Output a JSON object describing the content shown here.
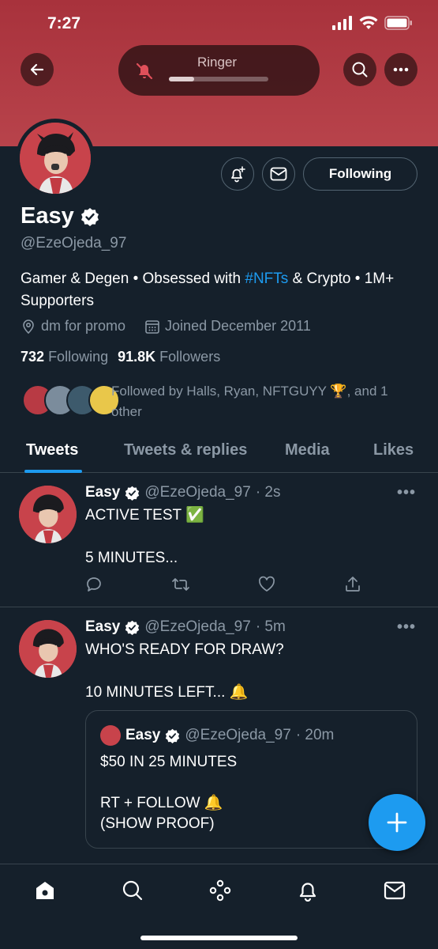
{
  "status_bar": {
    "time": "7:27"
  },
  "ringer": {
    "label": "Ringer",
    "level": 0.25
  },
  "profile": {
    "name": "Easy",
    "handle": "@EzeOjeda_97",
    "bio_prefix": "Gamer & Degen • Obsessed with ",
    "bio_link": "#NFTs",
    "bio_suffix": " & Crypto • 1M+ Supporters",
    "location": "dm for promo",
    "joined": "Joined December 2011",
    "following_count": "732",
    "following_label": "Following",
    "followers_count": "91.8K",
    "followers_label": "Followers",
    "followed_by": "Followed by Halls, Ryan, NFTGUYY 🏆, and 1 other",
    "follow_button": "Following"
  },
  "tabs": [
    {
      "label": "Tweets",
      "active": true
    },
    {
      "label": "Tweets & replies",
      "active": false
    },
    {
      "label": "Media",
      "active": false
    },
    {
      "label": "Likes",
      "active": false
    }
  ],
  "tweets": [
    {
      "name": "Easy",
      "handle": "@EzeOjeda_97",
      "time": "· 2s",
      "text": "ACTIVE TEST ✅\n\n5 MINUTES..."
    },
    {
      "name": "Easy",
      "handle": "@EzeOjeda_97",
      "time": "· 5m",
      "text": "WHO'S READY FOR DRAW?\n\n10 MINUTES LEFT... 🔔",
      "quote": {
        "name": "Easy",
        "handle": "@EzeOjeda_97",
        "time": "· 20m",
        "text": "$50 IN 25 MINUTES\n\nRT + FOLLOW 🔔\n(SHOW PROOF)"
      }
    }
  ],
  "more_glyph": "•••",
  "colors": {
    "accent": "#1d9bf0",
    "background": "#15202b",
    "banner": "#b03a43"
  }
}
